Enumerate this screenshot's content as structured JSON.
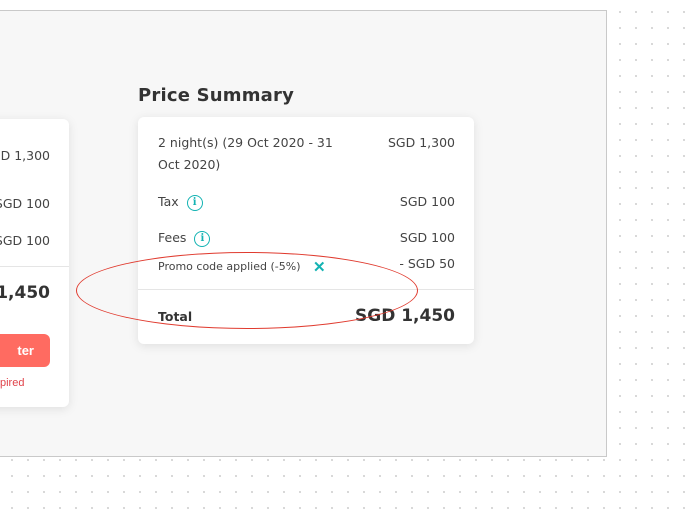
{
  "left_card": {
    "stay_price": "D 1,300",
    "tax_price": "SGD 100",
    "fees_price": "SGD 100",
    "total_price": "1,450",
    "button_label": "ter",
    "expired_text": "pired"
  },
  "summary": {
    "heading": "Price Summary",
    "stay_label_line1": "2 night(s) (29 Oct 2020 - 31",
    "stay_label_line2": "Oct 2020)",
    "stay_price": "SGD 1,300",
    "tax_label": "Tax",
    "tax_price": "SGD 100",
    "fees_label": "Fees",
    "fees_price": "SGD 100",
    "promo_label": "Promo code applied (-5%)",
    "promo_price": "- SGD 50",
    "total_label": "Total",
    "total_price": "SGD 1,450",
    "info_glyph": "i",
    "close_glyph": "✕"
  },
  "colors": {
    "accent_teal": "#14b3b3",
    "button_coral": "#ff6b61",
    "annotation_red": "#e03b2f"
  }
}
